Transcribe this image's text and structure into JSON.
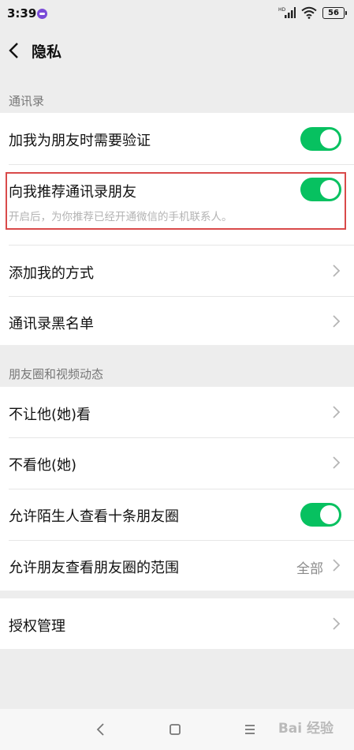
{
  "status_bar": {
    "time": "3:39",
    "battery": "56",
    "icons": [
      "notification-icon",
      "hd-signal-icon",
      "wifi-icon",
      "battery-icon"
    ]
  },
  "header": {
    "title": "隐私"
  },
  "sections": {
    "contacts": {
      "label": "通讯录",
      "items": {
        "verify": {
          "label": "加我为朋友时需要验证",
          "toggle": true
        },
        "recommend": {
          "label": "向我推荐通讯录朋友",
          "sub": "开启后，为你推荐已经开通微信的手机联系人。",
          "toggle": true
        },
        "add_ways": {
          "label": "添加我的方式"
        },
        "blacklist": {
          "label": "通讯录黑名单"
        }
      }
    },
    "moments": {
      "label": "朋友圈和视频动态",
      "items": {
        "hide_from": {
          "label": "不让他(她)看"
        },
        "hide_them": {
          "label": "不看他(她)"
        },
        "strangers": {
          "label": "允许陌生人查看十条朋友圈",
          "toggle": true
        },
        "range": {
          "label": "允许朋友查看朋友圈的范围",
          "value": "全部"
        }
      }
    },
    "auth": {
      "label": "授权管理"
    }
  },
  "nav_bar": {
    "watermark": "Bai 经验"
  },
  "colors": {
    "toggle_on": "#07c160",
    "highlight": "#d94a4a",
    "background": "#ededed"
  }
}
